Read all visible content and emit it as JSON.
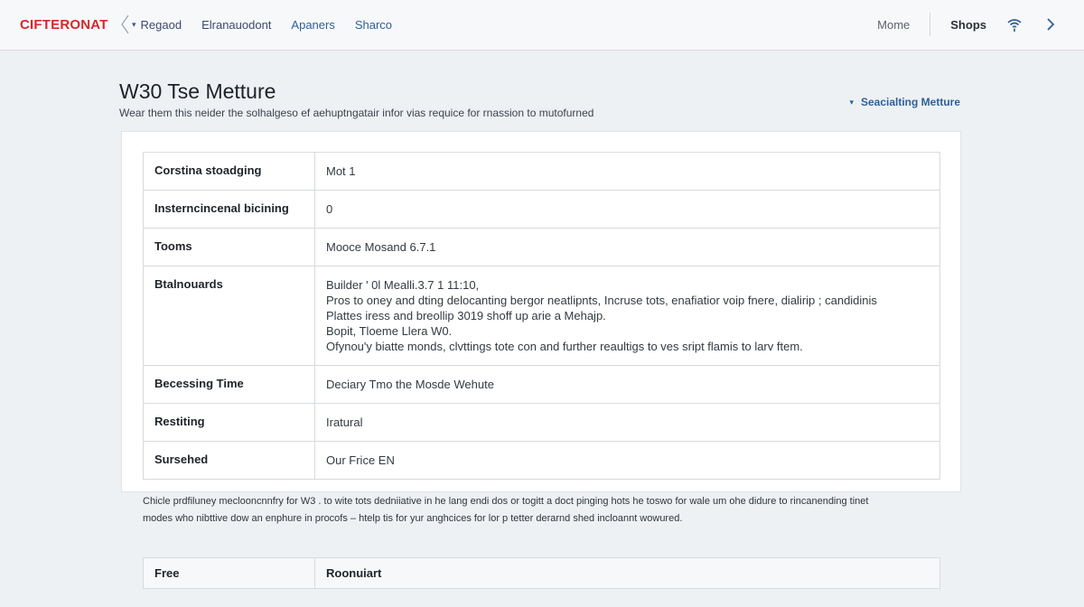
{
  "topbar": {
    "brand": "CIFTERONAT",
    "nav": [
      {
        "label": "Regaod",
        "caret": "▾"
      },
      {
        "label": "Elranauodont"
      },
      {
        "label": "Apaners"
      },
      {
        "label": "Sharco"
      }
    ],
    "more": "Mome",
    "shops": "Shops"
  },
  "header": {
    "title": "W30 Tse Metture",
    "subtitle": "Wear them this neider the solhalgeso ef aehuptngatair infor vias requice for rnassion to mutofurned",
    "side_link": "Seacialting Metture",
    "side_caret": "▾"
  },
  "specs": [
    {
      "key": "Corstina stoadging",
      "value": [
        "Mot 1"
      ]
    },
    {
      "key": "Insterncincenal bicining",
      "value": [
        "0"
      ]
    },
    {
      "key": "Tooms",
      "value": [
        "Mooce Mosand 6.7.1"
      ]
    },
    {
      "key": "Btalnouards",
      "value": [
        "Builder ' 0l Mealli.3.7 1 11:10,",
        "Pros to oney and dting delocanting bergor neatlipnts, Incruse tots, enafiatior voip fnere, dialirip ; candidinis",
        "Plattes iress and breollip 3019 shoff up arie a Mehajp.",
        "Bopit, Tloeme Llera W0.",
        "Ofynou'y biatte monds, clvttings tote con and further reaultigs to ves sript flamis to larv ftem."
      ]
    },
    {
      "key": "Becessing Time",
      "value": [
        "Deciary Tmo the Mosde Wehute"
      ]
    },
    {
      "key": "Restiting",
      "value": [
        "Iratural"
      ]
    },
    {
      "key": "Sursehed",
      "value": [
        "Our Frice EN"
      ]
    }
  ],
  "footnote": [
    "Chicle prdfiluney meclooncnnfry for W3 . to wite tots dedniiative in he lang endi dos or togitt a doct pinging hots he toswo for wale um ohe didure to rincanending tinet",
    "modes who nibttive dow an enphure in procofs – htelp tis for yur anghcices for lor p tetter derarnd shed incloannt wowured."
  ],
  "bottom_row": {
    "key": "Free",
    "value": "Roonuiart"
  },
  "colors": {
    "brand": "#d9262c",
    "accent": "#2e5f9a",
    "background": "#eef1f4"
  }
}
